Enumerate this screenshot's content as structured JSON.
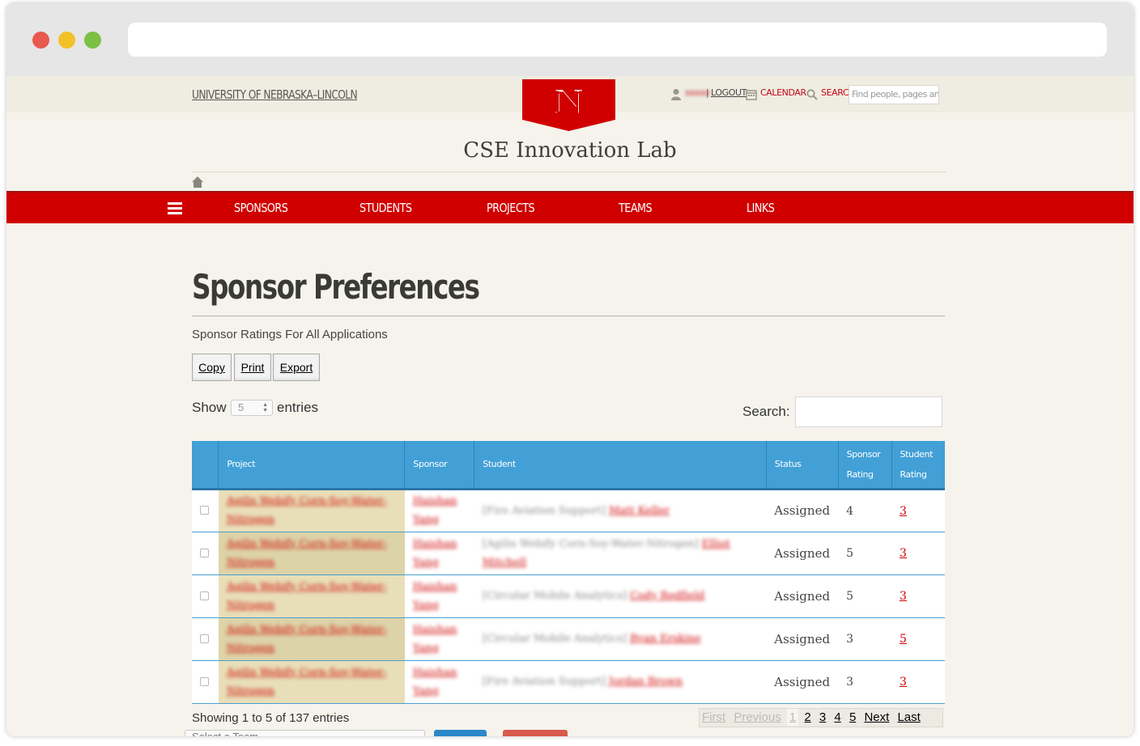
{
  "header": {
    "university_link": "UNIVERSITY OF NEBRASKA–LINCOLN",
    "user_name": "xxxxx",
    "logout": "LOGOUT",
    "calendar": "CALENDAR",
    "search_label": "SEARCH",
    "search_placeholder": "Find people, pages and thi",
    "site_title": "CSE Innovation Lab",
    "colors": {
      "brand_red": "#d00000",
      "table_header": "#42a0d6"
    }
  },
  "nav": {
    "items": [
      {
        "label": "SPONSORS"
      },
      {
        "label": "STUDENTS"
      },
      {
        "label": "PROJECTS"
      },
      {
        "label": "TEAMS"
      },
      {
        "label": "LINKS"
      }
    ]
  },
  "main": {
    "heading": "Sponsor Preferences",
    "subtitle": "Sponsor Ratings For All Applications",
    "buttons": {
      "copy": "Copy",
      "print": "Print",
      "export": "Export"
    },
    "length": {
      "show": "Show",
      "value": "5",
      "entries": "entries"
    },
    "search_label": "Search:",
    "table": {
      "columns": [
        "Project",
        "Sponsor",
        "Student",
        "Status",
        "Sponsor Rating",
        "Student Rating"
      ],
      "rows": [
        {
          "project": "Agilis Webify Corn-Soy-Water-Nitrogen",
          "sponsor": "Haishan Yang",
          "student_project": "[Fire Aviation Support]",
          "student": "Matt Keller",
          "status": "Assigned",
          "sponsor_rating": "4",
          "student_rating": "3"
        },
        {
          "project": "Agilis Webify Corn-Soy-Water-Nitrogen",
          "sponsor": "Haishan Yang",
          "student_project": "[Agilis Webify Corn-Soy-Water-Nitrogen]",
          "student": "Elliot Mitchell",
          "status": "Assigned",
          "sponsor_rating": "5",
          "student_rating": "3"
        },
        {
          "project": "Agilis Webify Corn-Soy-Water-Nitrogen",
          "sponsor": "Haishan Yang",
          "student_project": "[Circular Mobile Analytics]",
          "student": "Cody Redfield",
          "status": "Assigned",
          "sponsor_rating": "5",
          "student_rating": "3"
        },
        {
          "project": "Agilis Webify Corn-Soy-Water-Nitrogen",
          "sponsor": "Haishan Yang",
          "student_project": "[Circular Mobile Analytics]",
          "student": "Ryan Erskine",
          "status": "Assigned",
          "sponsor_rating": "3",
          "student_rating": "5"
        },
        {
          "project": "Agilis Webify Corn-Soy-Water-Nitrogen",
          "sponsor": "Haishan Yang",
          "student_project": "[Fire Aviation Support]",
          "student": "Jordan Brown",
          "status": "Assigned",
          "sponsor_rating": "3",
          "student_rating": "3"
        }
      ]
    },
    "info": "Showing 1 to 5 of 137 entries",
    "pager": {
      "first": "First",
      "previous": "Previous",
      "pages": [
        "1",
        "2",
        "3",
        "4",
        "5"
      ],
      "next": "Next",
      "last": "Last"
    },
    "bottom_select": "Select a Team"
  }
}
